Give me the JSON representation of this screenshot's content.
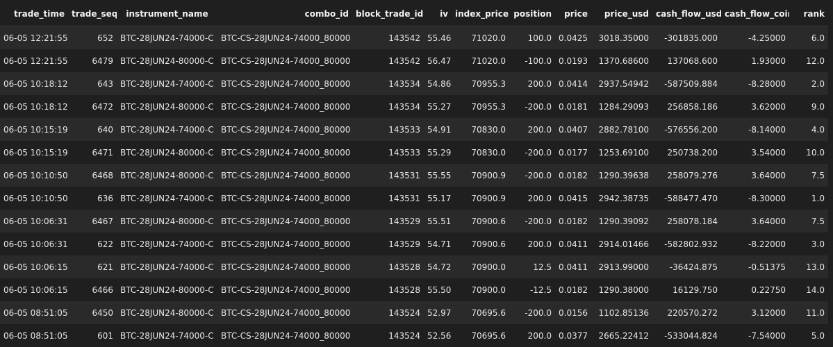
{
  "table": {
    "headers": [
      "trade_time",
      "trade_seq",
      "instrument_name",
      "combo_id",
      "block_trade_id",
      "iv",
      "index_price",
      "position",
      "price",
      "price_usd",
      "cash_flow_usd",
      "cash_flow_coin",
      "rank"
    ],
    "rows": [
      [
        "06-05 12:21:55",
        "652",
        "BTC-28JUN24-74000-C",
        "BTC-CS-28JUN24-74000_80000",
        "143542",
        "55.46",
        "71020.0",
        "100.0",
        "0.0425",
        "3018.35000",
        "-301835.000",
        "-4.25000",
        "6.0"
      ],
      [
        "06-05 12:21:55",
        "6479",
        "BTC-28JUN24-80000-C",
        "BTC-CS-28JUN24-74000_80000",
        "143542",
        "56.47",
        "71020.0",
        "-100.0",
        "0.0193",
        "1370.68600",
        "137068.600",
        "1.93000",
        "12.0"
      ],
      [
        "06-05 10:18:12",
        "643",
        "BTC-28JUN24-74000-C",
        "BTC-CS-28JUN24-74000_80000",
        "143534",
        "54.86",
        "70955.3",
        "200.0",
        "0.0414",
        "2937.54942",
        "-587509.884",
        "-8.28000",
        "2.0"
      ],
      [
        "06-05 10:18:12",
        "6472",
        "BTC-28JUN24-80000-C",
        "BTC-CS-28JUN24-74000_80000",
        "143534",
        "55.27",
        "70955.3",
        "-200.0",
        "0.0181",
        "1284.29093",
        "256858.186",
        "3.62000",
        "9.0"
      ],
      [
        "06-05 10:15:19",
        "640",
        "BTC-28JUN24-74000-C",
        "BTC-CS-28JUN24-74000_80000",
        "143533",
        "54.91",
        "70830.0",
        "200.0",
        "0.0407",
        "2882.78100",
        "-576556.200",
        "-8.14000",
        "4.0"
      ],
      [
        "06-05 10:15:19",
        "6471",
        "BTC-28JUN24-80000-C",
        "BTC-CS-28JUN24-74000_80000",
        "143533",
        "55.29",
        "70830.0",
        "-200.0",
        "0.0177",
        "1253.69100",
        "250738.200",
        "3.54000",
        "10.0"
      ],
      [
        "06-05 10:10:50",
        "6468",
        "BTC-28JUN24-80000-C",
        "BTC-CS-28JUN24-74000_80000",
        "143531",
        "55.55",
        "70900.9",
        "-200.0",
        "0.0182",
        "1290.39638",
        "258079.276",
        "3.64000",
        "7.5"
      ],
      [
        "06-05 10:10:50",
        "636",
        "BTC-28JUN24-74000-C",
        "BTC-CS-28JUN24-74000_80000",
        "143531",
        "55.17",
        "70900.9",
        "200.0",
        "0.0415",
        "2942.38735",
        "-588477.470",
        "-8.30000",
        "1.0"
      ],
      [
        "06-05 10:06:31",
        "6467",
        "BTC-28JUN24-80000-C",
        "BTC-CS-28JUN24-74000_80000",
        "143529",
        "55.51",
        "70900.6",
        "-200.0",
        "0.0182",
        "1290.39092",
        "258078.184",
        "3.64000",
        "7.5"
      ],
      [
        "06-05 10:06:31",
        "622",
        "BTC-28JUN24-74000-C",
        "BTC-CS-28JUN24-74000_80000",
        "143529",
        "54.71",
        "70900.6",
        "200.0",
        "0.0411",
        "2914.01466",
        "-582802.932",
        "-8.22000",
        "3.0"
      ],
      [
        "06-05 10:06:15",
        "621",
        "BTC-28JUN24-74000-C",
        "BTC-CS-28JUN24-74000_80000",
        "143528",
        "54.72",
        "70900.0",
        "12.5",
        "0.0411",
        "2913.99000",
        "-36424.875",
        "-0.51375",
        "13.0"
      ],
      [
        "06-05 10:06:15",
        "6466",
        "BTC-28JUN24-80000-C",
        "BTC-CS-28JUN24-74000_80000",
        "143528",
        "55.50",
        "70900.0",
        "-12.5",
        "0.0182",
        "1290.38000",
        "16129.750",
        "0.22750",
        "14.0"
      ],
      [
        "06-05 08:51:05",
        "6450",
        "BTC-28JUN24-80000-C",
        "BTC-CS-28JUN24-74000_80000",
        "143524",
        "52.97",
        "70695.6",
        "-200.0",
        "0.0156",
        "1102.85136",
        "220570.272",
        "3.12000",
        "11.0"
      ],
      [
        "06-05 08:51:05",
        "601",
        "BTC-28JUN24-74000-C",
        "BTC-CS-28JUN24-74000_80000",
        "143524",
        "52.56",
        "70695.6",
        "200.0",
        "0.0377",
        "2665.22412",
        "-533044.824",
        "-7.54000",
        "5.0"
      ]
    ]
  },
  "colors": {
    "background": "#1f1f1f",
    "row_alt": "#2a2a2a",
    "text": "#e6e6e6"
  }
}
